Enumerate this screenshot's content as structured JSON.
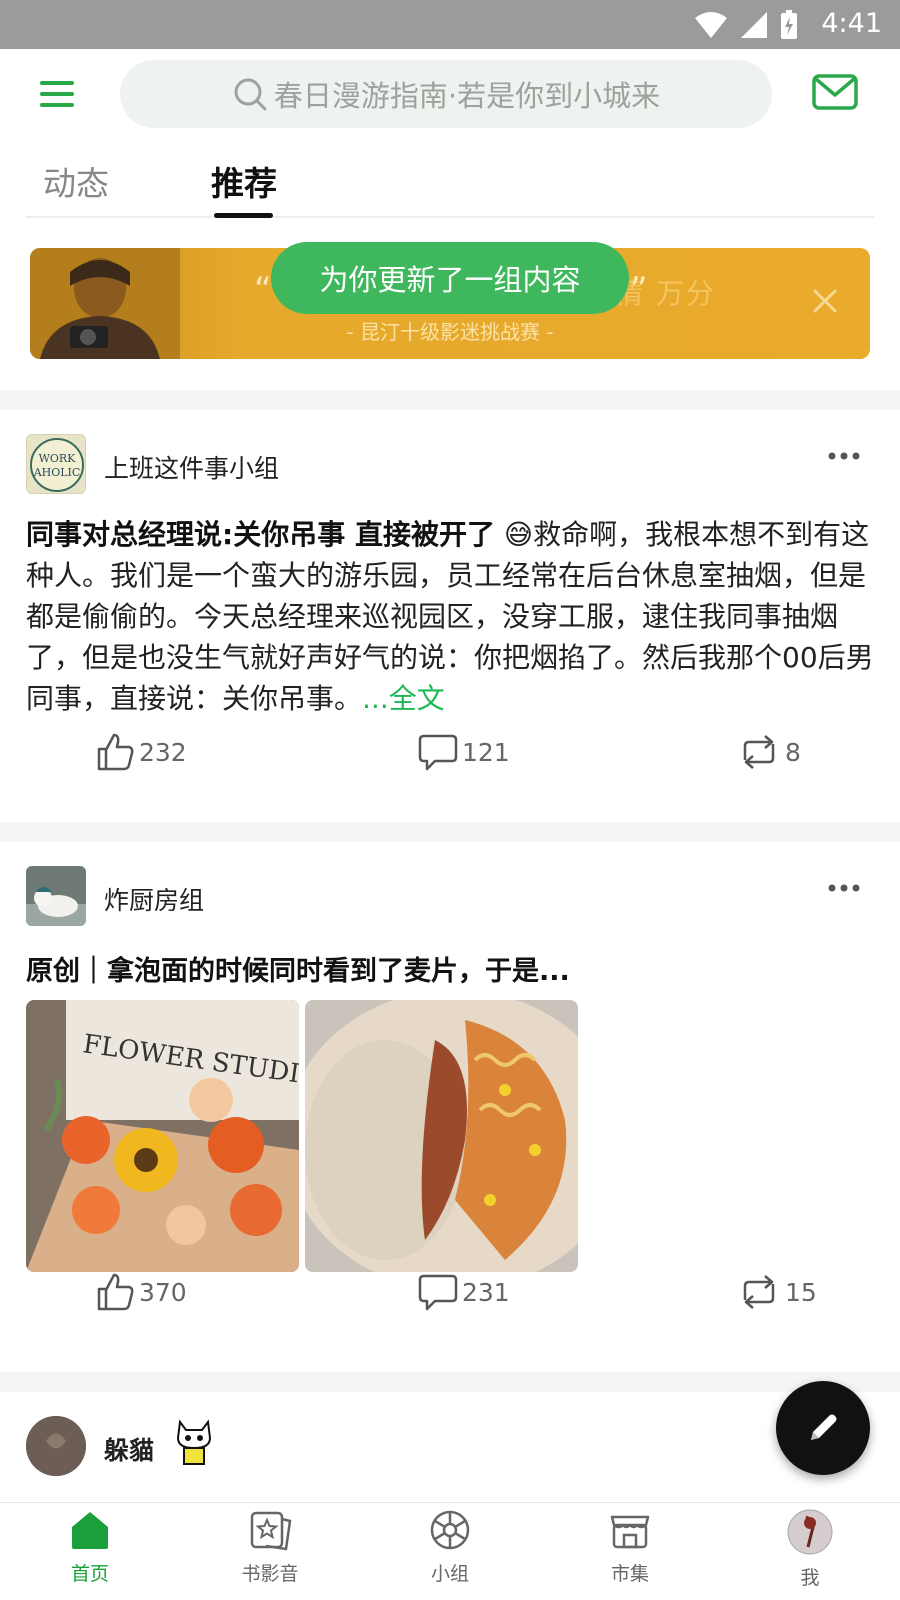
{
  "status_bar": {
    "time": "4:41"
  },
  "search": {
    "placeholder": "春日漫游指南·若是你到小城来"
  },
  "tabs": [
    {
      "label": "动态"
    },
    {
      "label": "推荐"
    }
  ],
  "banner": {
    "quote_open": "“",
    "title": "暴雨也挡不住看电影的热情 万分",
    "quote_close": "”",
    "subtitle": "- 昆汀十级影迷挑战赛 -"
  },
  "toast": {
    "text": "为你更新了一组内容"
  },
  "posts": [
    {
      "group": "上班这件事小组",
      "avatar_text": "WORK AHOLIC",
      "title": "同事对总经理说:关你吊事 直接被开了",
      "emoji": "😅",
      "body": "救命啊，我根本想不到有这种人。我们是一个蛮大的游乐园，员工经常在后台休息室抽烟，但是都是偷偷的。今天总经理来巡视园区，没穿工服，逮住我同事抽烟了，但是也没生气就好声好气的说：你把烟掐了。然后我那个00后男同事，直接说：关你吊事。",
      "more_link": "...全文",
      "likes": "232",
      "comments": "121",
      "reposts": "8"
    },
    {
      "group": "炸厨房组",
      "title": "原创｜拿泡面的时候同时看到了麦片，于是...",
      "images": [
        {
          "label": "FLOWER STUDIO"
        },
        {
          "label": "noodles"
        }
      ],
      "likes": "370",
      "comments": "231",
      "reposts": "15"
    },
    {
      "group": "躲貓"
    }
  ],
  "bottom_nav": [
    {
      "label": "首页",
      "icon": "home-icon",
      "active": true
    },
    {
      "label": "书影音",
      "icon": "film-icon",
      "active": false
    },
    {
      "label": "小组",
      "icon": "group-icon",
      "active": false
    },
    {
      "label": "市集",
      "icon": "store-icon",
      "active": false
    },
    {
      "label": "我",
      "icon": "profile-icon",
      "active": false
    }
  ],
  "colors": {
    "accent": "#1a9f3a",
    "toast": "#3fb75c",
    "banner": "#eaaa2b",
    "status_bar": "#9b9b9b"
  }
}
